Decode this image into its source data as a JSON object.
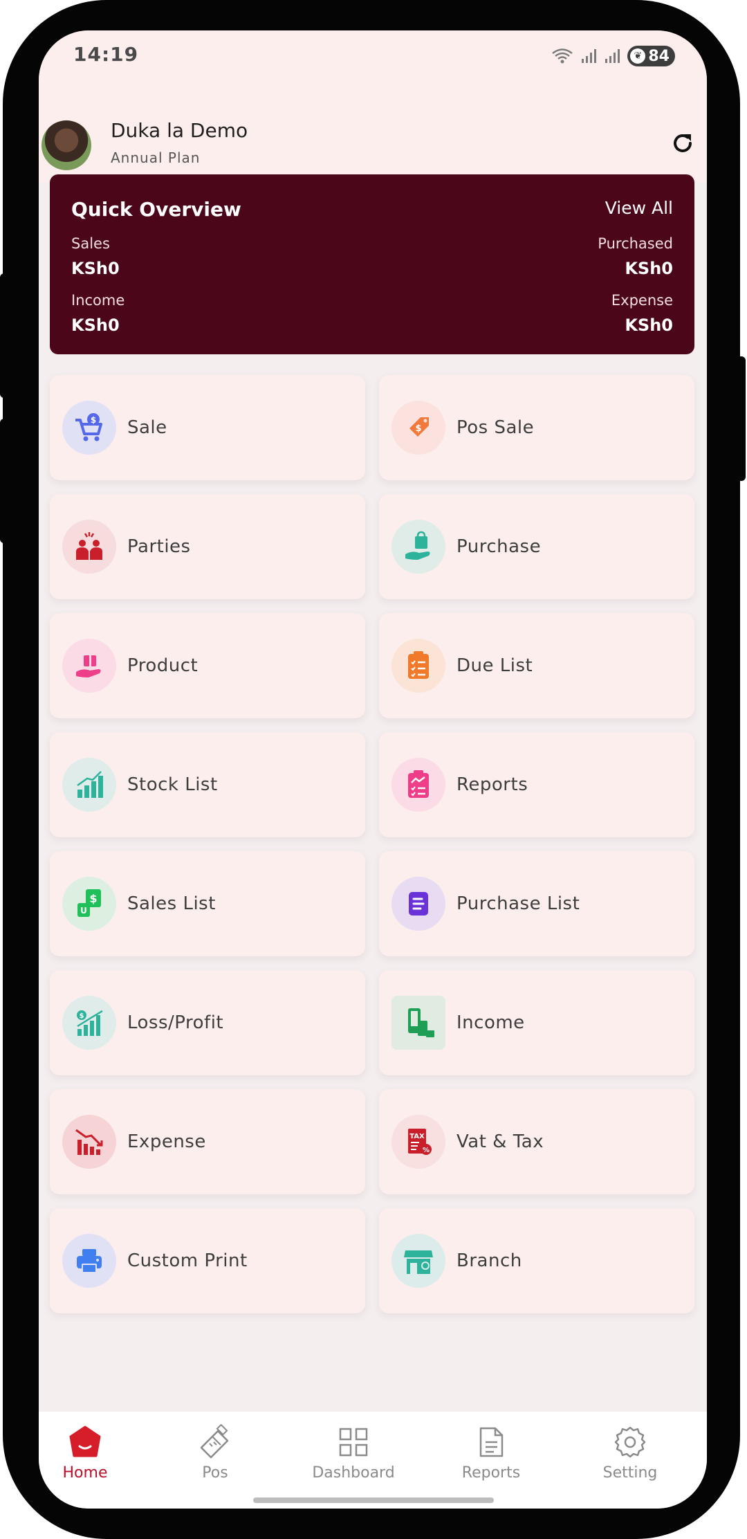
{
  "status_bar": {
    "time": "14:19",
    "battery": "84"
  },
  "header": {
    "shop_name": "Duka la Demo",
    "plan": "Annual Plan"
  },
  "overview": {
    "title": "Quick Overview",
    "view_all": "View All",
    "sales_label": "Sales",
    "sales_value": "KSh0",
    "purchased_label": "Purchased",
    "purchased_value": "KSh0",
    "income_label": "Income",
    "income_value": "KSh0",
    "expense_label": "Expense",
    "expense_value": "KSh0"
  },
  "menu": [
    {
      "label": "Sale",
      "icon": "cart-icon",
      "bg": "#e1e1f6"
    },
    {
      "label": "Pos Sale",
      "icon": "price-tag-icon",
      "bg": "#fbe2de"
    },
    {
      "label": "Parties",
      "icon": "parties-icon",
      "bg": "#f6dcdc"
    },
    {
      "label": "Purchase",
      "icon": "purchase-bag-icon",
      "bg": "#dfece8"
    },
    {
      "label": "Product",
      "icon": "gift-hand-icon",
      "bg": "#fadbe6"
    },
    {
      "label": "Due List",
      "icon": "checklist-icon",
      "bg": "#fbe4d6"
    },
    {
      "label": "Stock List",
      "icon": "bar-chart-icon",
      "bg": "#e0ece9"
    },
    {
      "label": "Reports",
      "icon": "report-clipboard-icon",
      "bg": "#fadbe6"
    },
    {
      "label": "Sales List",
      "icon": "cash-icon",
      "bg": "#dcefe1"
    },
    {
      "label": "Purchase List",
      "icon": "document-list-icon",
      "bg": "#e7dcf2"
    },
    {
      "label": "Loss/Profit",
      "icon": "growth-chart-icon",
      "bg": "#e0ece9"
    },
    {
      "label": "Income",
      "icon": "income-devices-icon",
      "bg": "#e0ece2"
    },
    {
      "label": "Expense",
      "icon": "declining-chart-icon",
      "bg": "#f6d4d6"
    },
    {
      "label": "Vat & Tax",
      "icon": "tax-document-icon",
      "bg": "#f8e0e0"
    },
    {
      "label": "Custom Print",
      "icon": "printer-icon",
      "bg": "#e1e1f6"
    },
    {
      "label": "Branch",
      "icon": "store-location-icon",
      "bg": "#dcecea"
    }
  ],
  "bottom_nav": [
    {
      "label": "Home",
      "icon": "home-icon",
      "active": true
    },
    {
      "label": "Pos",
      "icon": "pos-terminal-icon",
      "active": false
    },
    {
      "label": "Dashboard",
      "icon": "dashboard-grid-icon",
      "active": false
    },
    {
      "label": "Reports",
      "icon": "reports-document-icon",
      "active": false
    },
    {
      "label": "Setting",
      "icon": "gear-icon",
      "active": false
    }
  ],
  "colors": {
    "overview_bg": "#4b0719",
    "accent": "#b8102a",
    "card_bg": "#fdeeee"
  }
}
